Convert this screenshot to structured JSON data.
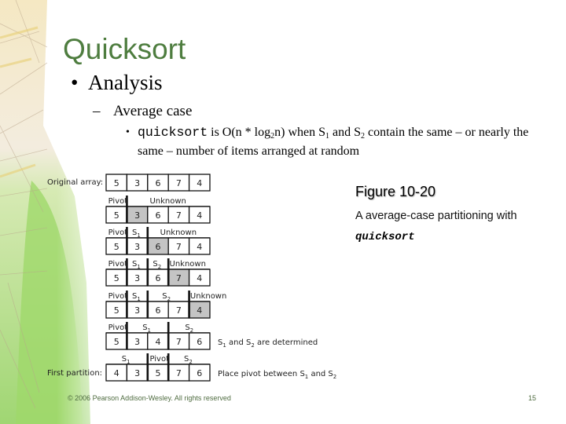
{
  "slide": {
    "title": "Quicksort",
    "bullet_l1": "Analysis",
    "bullet_l2": "Average case",
    "bullet_l3": {
      "code": "quicksort",
      "text_a": " is O(n * log",
      "sub_a": "2",
      "text_b": "n) when S",
      "sub_b": "1",
      "text_c": " and S",
      "sub_c": "2",
      "text_d": " contain the same – or nearly the same – number of items arranged at random"
    },
    "bullet_glyph": "•",
    "dash_glyph": "–",
    "small_bullet_glyph": "•"
  },
  "figure": {
    "row_labels": {
      "original": "Original array:",
      "first_partition": "First partition:"
    },
    "rows": [
      {
        "values": [
          "5",
          "3",
          "6",
          "7",
          "4"
        ],
        "highlight": null,
        "labels": [],
        "dividers_after": [],
        "note": null
      },
      {
        "values": [
          "5",
          "3",
          "6",
          "7",
          "4"
        ],
        "highlight": 1,
        "labels": [
          {
            "text": "Pivot",
            "sub": ""
          },
          {
            "text": "Unknown",
            "sub": ""
          }
        ],
        "dividers_after": [
          1
        ],
        "note": null
      },
      {
        "values": [
          "5",
          "3",
          "6",
          "7",
          "4"
        ],
        "highlight": 2,
        "labels": [
          {
            "text": "Pivot",
            "sub": ""
          },
          {
            "text": "S",
            "sub": "1"
          },
          {
            "text": "Unknown",
            "sub": ""
          }
        ],
        "dividers_after": [
          1,
          2
        ],
        "note": null
      },
      {
        "values": [
          "5",
          "3",
          "6",
          "7",
          "4"
        ],
        "highlight": 3,
        "labels": [
          {
            "text": "Pivot",
            "sub": ""
          },
          {
            "text": "S",
            "sub": "1"
          },
          {
            "text": "S",
            "sub": "2"
          },
          {
            "text": "Unknown",
            "sub": ""
          }
        ],
        "dividers_after": [
          1,
          2,
          3
        ],
        "note": null
      },
      {
        "values": [
          "5",
          "3",
          "6",
          "7",
          "4"
        ],
        "highlight": 4,
        "labels": [
          {
            "text": "Pivot",
            "sub": ""
          },
          {
            "text": "S",
            "sub": "1"
          },
          {
            "text": "S",
            "sub": "2"
          },
          {
            "text": "Unknown",
            "sub": ""
          }
        ],
        "dividers_after": [
          1,
          2,
          4
        ],
        "note": null
      },
      {
        "values": [
          "5",
          "3",
          "4",
          "7",
          "6"
        ],
        "highlight": null,
        "labels": [
          {
            "text": "Pivot",
            "sub": ""
          },
          {
            "text": "S",
            "sub": "1"
          },
          {
            "text": "S",
            "sub": "2"
          }
        ],
        "dividers_after": [
          1,
          3
        ],
        "note": {
          "parts": [
            {
              "text": "S",
              "sub": "1"
            },
            {
              "text": " and S",
              "sub": "2"
            },
            {
              "text": " are determined",
              "sub": ""
            }
          ]
        }
      },
      {
        "values": [
          "4",
          "3",
          "5",
          "7",
          "6"
        ],
        "highlight": null,
        "labels": [
          {
            "text": "S",
            "sub": "1"
          },
          {
            "text": "Pivot",
            "sub": ""
          },
          {
            "text": "S",
            "sub": "2"
          }
        ],
        "dividers_after": [
          2,
          3
        ],
        "note": {
          "parts": [
            {
              "text": "Place pivot between S",
              "sub": "1"
            },
            {
              "text": " and S",
              "sub": "2"
            }
          ]
        }
      }
    ],
    "colors": {
      "highlight": "#c4c4c4",
      "border": "#111111"
    }
  },
  "caption": {
    "title": "Figure 10-20",
    "text": "A average-case partitioning with",
    "code": "quicksort"
  },
  "footer": {
    "copyright": "© 2006 Pearson Addison-Wesley. All rights reserved",
    "page_number": "15"
  }
}
